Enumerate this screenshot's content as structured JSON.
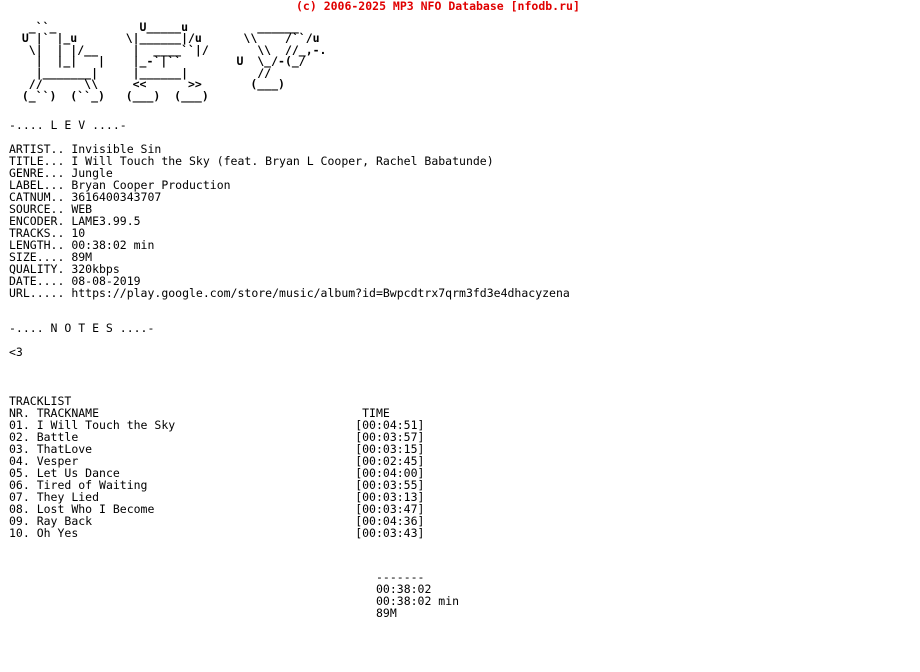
{
  "header": {
    "credit": "(c) 2006-2025 MP3 NFO Database [nfodb.ru]",
    "credit_color": "#e00000"
  },
  "ascii_logo": {
    "name": "lev-ascii-logo",
    "lines": [
      "               U_____u          ______",
      "       _``_   \\|______|/u      \\\\    /``/u",
      "  U  |` |_u    |  ____``|/       \\\\  //_,-.",
      "   \\ |  |/__   |_-`|``         U  \\_/-(_/",
      "    |______|   |______|           //",
      "   //    \\\\    <<    >>          (___)",
      "  (_``)(``_)  (___) (___)"
    ],
    "raw": "ASCII art banner reading LEV"
  },
  "release_heading": "-.... L E V ....-",
  "info": {
    "fields": [
      {
        "label": "ARTIST..",
        "value": "Invisible Sin"
      },
      {
        "label": "TITLE...",
        "value": "I Will Touch the Sky (feat. Bryan L Cooper, Rachel Babatunde)"
      },
      {
        "label": "GENRE...",
        "value": "Jungle"
      },
      {
        "label": "LABEL...",
        "value": "Bryan Cooper Production"
      },
      {
        "label": "CATNUM..",
        "value": "3616400343707"
      },
      {
        "label": "SOURCE..",
        "value": "WEB"
      },
      {
        "label": "ENCODER.",
        "value": "LAME3.99.5"
      },
      {
        "label": "TRACKS..",
        "value": "10"
      },
      {
        "label": "LENGTH..",
        "value": "00:38:02 min"
      },
      {
        "label": "SIZE....",
        "value": "89M"
      },
      {
        "label": "QUALITY.",
        "value": "320kbps"
      },
      {
        "label": "DATE....",
        "value": "08-08-2019"
      },
      {
        "label": "URL.....",
        "value": "https://play.google.com/store/music/album?id=Bwpcdtrx7qrm3fd3e4dhacyzena"
      }
    ]
  },
  "notes": {
    "heading": "-.... N O T E S ....-",
    "body": "<3"
  },
  "tracklist": {
    "title": "TRACKLIST",
    "columns": {
      "nr": "NR.",
      "trackname": "TRACKNAME",
      "time": "TIME"
    },
    "tracks": [
      {
        "nr": "01.",
        "name": "I Will Touch the Sky",
        "time": "[00:04:51]"
      },
      {
        "nr": "02.",
        "name": "Battle",
        "time": "[00:03:57]"
      },
      {
        "nr": "03.",
        "name": "ThatLove",
        "time": "[00:03:15]"
      },
      {
        "nr": "04.",
        "name": "Vesper",
        "time": "[00:02:45]"
      },
      {
        "nr": "05.",
        "name": "Let Us Dance",
        "time": "[00:04:00]"
      },
      {
        "nr": "06.",
        "name": "Tired of Waiting",
        "time": "[00:03:55]"
      },
      {
        "nr": "07.",
        "name": "They Lied",
        "time": "[00:03:13]"
      },
      {
        "nr": "08.",
        "name": "Lost Who I Become",
        "time": "[00:03:47]"
      },
      {
        "nr": "09.",
        "name": "Ray Back",
        "time": "[00:04:36]"
      },
      {
        "nr": "10.",
        "name": "Oh Yes",
        "time": "[00:03:43]"
      }
    ]
  },
  "totals": {
    "separator": "-------",
    "total_time": "00:38:02",
    "total_length": "00:38:02 min",
    "total_size": "89M"
  }
}
